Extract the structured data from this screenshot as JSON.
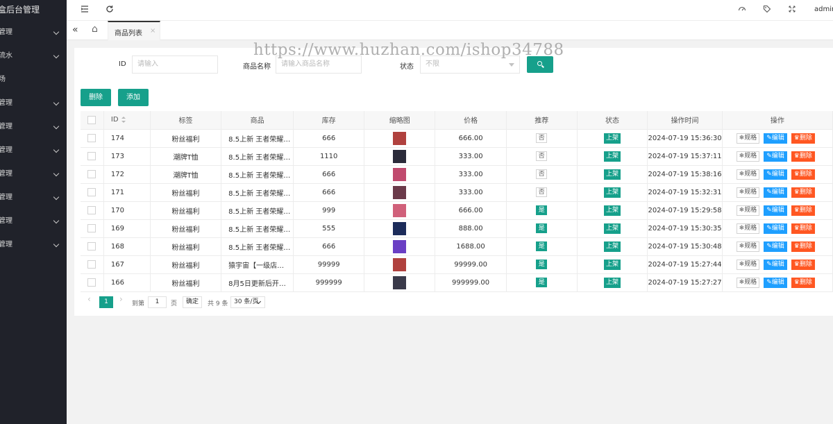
{
  "sidebar": {
    "brand": "盒后台管理",
    "items": [
      {
        "label": "管理"
      },
      {
        "label": "流水"
      },
      {
        "label": "场"
      },
      {
        "label": "管理"
      },
      {
        "label": "管理"
      },
      {
        "label": "管理"
      },
      {
        "label": "管理"
      },
      {
        "label": "管理"
      },
      {
        "label": "管理"
      },
      {
        "label": "管理"
      }
    ]
  },
  "header": {
    "user": "admin",
    "icons": [
      "menu-fold-icon",
      "refresh-icon",
      "theme-icon",
      "tag-icon",
      "fullscreen-icon"
    ]
  },
  "tabs": {
    "active_label": "商品列表",
    "close": "×",
    "back_glyph": "«",
    "home_glyph": "⌂"
  },
  "watermark": "https://www.huzhan.com/ishop34788",
  "filter": {
    "id_label": "ID",
    "id_placeholder": "请输入",
    "name_label": "商品名称",
    "name_placeholder": "请输入商品名称",
    "status_label": "状态",
    "status_value": "不限"
  },
  "toolbar": {
    "delete_label": "删除",
    "add_label": "添加"
  },
  "table": {
    "headers": {
      "id": "ID",
      "tag": "标签",
      "goods": "商品",
      "stock": "库存",
      "thumb": "缩略图",
      "price": "价格",
      "recommend": "推荐",
      "status": "状态",
      "time": "操作时间",
      "action": "操作"
    },
    "actions": {
      "spec": "❄规格",
      "edit": "✎编辑",
      "delete": "♛删除"
    },
    "rows": [
      {
        "id": "174",
        "tag": "粉丝福利",
        "goods": "8.5上新 王者荣耀…",
        "stock": "666",
        "price": "666.00",
        "recommend": "否",
        "status": "上架",
        "time": "2024-07-19 15:36:30",
        "thumb_color": "#b0413e"
      },
      {
        "id": "173",
        "tag": "潮牌T恤",
        "goods": "8.5上新 王者荣耀…",
        "stock": "1110",
        "price": "333.00",
        "recommend": "否",
        "status": "上架",
        "time": "2024-07-19 15:37:11",
        "thumb_color": "#2b2b3a"
      },
      {
        "id": "172",
        "tag": "潮牌T恤",
        "goods": "8.5上新 王者荣耀…",
        "stock": "666",
        "price": "333.00",
        "recommend": "否",
        "status": "上架",
        "time": "2024-07-19 15:38:16",
        "thumb_color": "#c04a6e"
      },
      {
        "id": "171",
        "tag": "粉丝福利",
        "goods": "8.5上新 王者荣耀…",
        "stock": "666",
        "price": "333.00",
        "recommend": "否",
        "status": "上架",
        "time": "2024-07-19 15:32:31",
        "thumb_color": "#6b3a4a"
      },
      {
        "id": "170",
        "tag": "粉丝福利",
        "goods": "8.5上新 王者荣耀…",
        "stock": "999",
        "price": "666.00",
        "recommend": "是",
        "status": "上架",
        "time": "2024-07-19 15:29:58",
        "thumb_color": "#d0607a"
      },
      {
        "id": "169",
        "tag": "粉丝福利",
        "goods": "8.5上新 王者荣耀…",
        "stock": "555",
        "price": "888.00",
        "recommend": "是",
        "status": "上架",
        "time": "2024-07-19 15:30:35",
        "thumb_color": "#1c2c5a"
      },
      {
        "id": "168",
        "tag": "粉丝福利",
        "goods": "8.5上新 王者荣耀…",
        "stock": "666",
        "price": "1688.00",
        "recommend": "是",
        "status": "上架",
        "time": "2024-07-19 15:30:48",
        "thumb_color": "#6a3fc4"
      },
      {
        "id": "167",
        "tag": "粉丝福利",
        "goods": "猿宇宙【一级店…",
        "stock": "99999",
        "price": "99999.00",
        "recommend": "是",
        "status": "上架",
        "time": "2024-07-19 15:27:44",
        "thumb_color": "#b0413e"
      },
      {
        "id": "166",
        "tag": "粉丝福利",
        "goods": "8月5日更新后开…",
        "stock": "999999",
        "price": "999999.00",
        "recommend": "是",
        "status": "上架",
        "time": "2024-07-19 15:27:27",
        "thumb_color": "#3a3a4a"
      }
    ]
  },
  "pagination": {
    "prev": "‹",
    "current": "1",
    "next": "›",
    "goto_label": "到第",
    "goto_value": "1",
    "page_unit": "页",
    "confirm": "确定",
    "total": "共 9 条",
    "page_size": "30 条/页"
  }
}
